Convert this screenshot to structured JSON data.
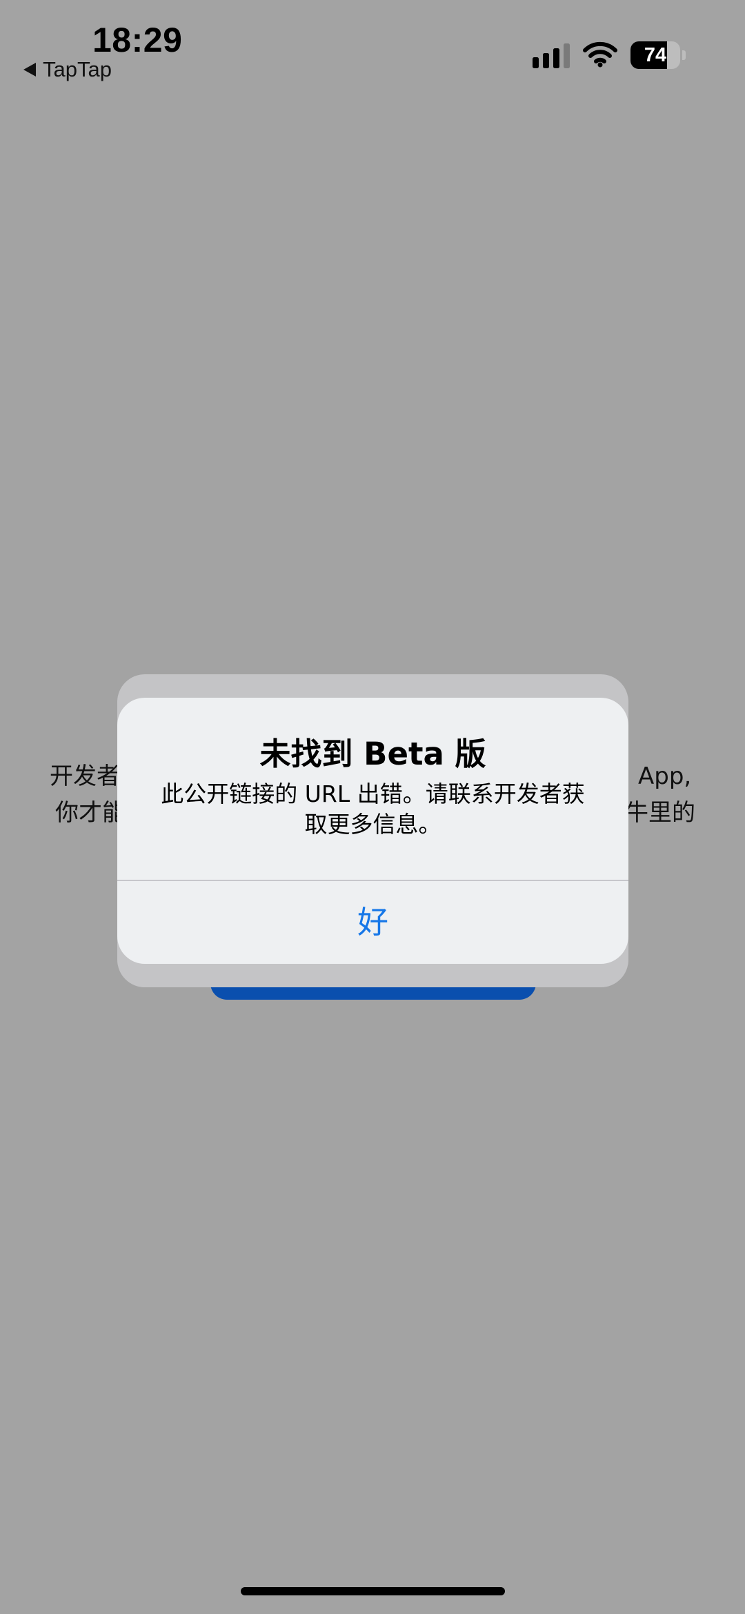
{
  "status_bar": {
    "time": "18:29",
    "back_app": "TapTap",
    "battery_percent": 74,
    "battery_label": "74",
    "icons": [
      "cellular-signal-icon",
      "wifi-icon",
      "battery-icon"
    ]
  },
  "background_page": {
    "line1_left": "开发者",
    "line1_right": "App,",
    "line2_left": "你才能",
    "line2_right": "牛里的"
  },
  "alert": {
    "title": "未找到 Beta 版",
    "message": "此公开链接的 URL 出错。请联系开发者获取更多信息。",
    "ok_label": "好"
  },
  "colors": {
    "overlay_background": "#a3a3a3",
    "alert_background": "#eef0f2",
    "alert_button_text": "#1677e8",
    "background_button": "#0a4fae"
  }
}
